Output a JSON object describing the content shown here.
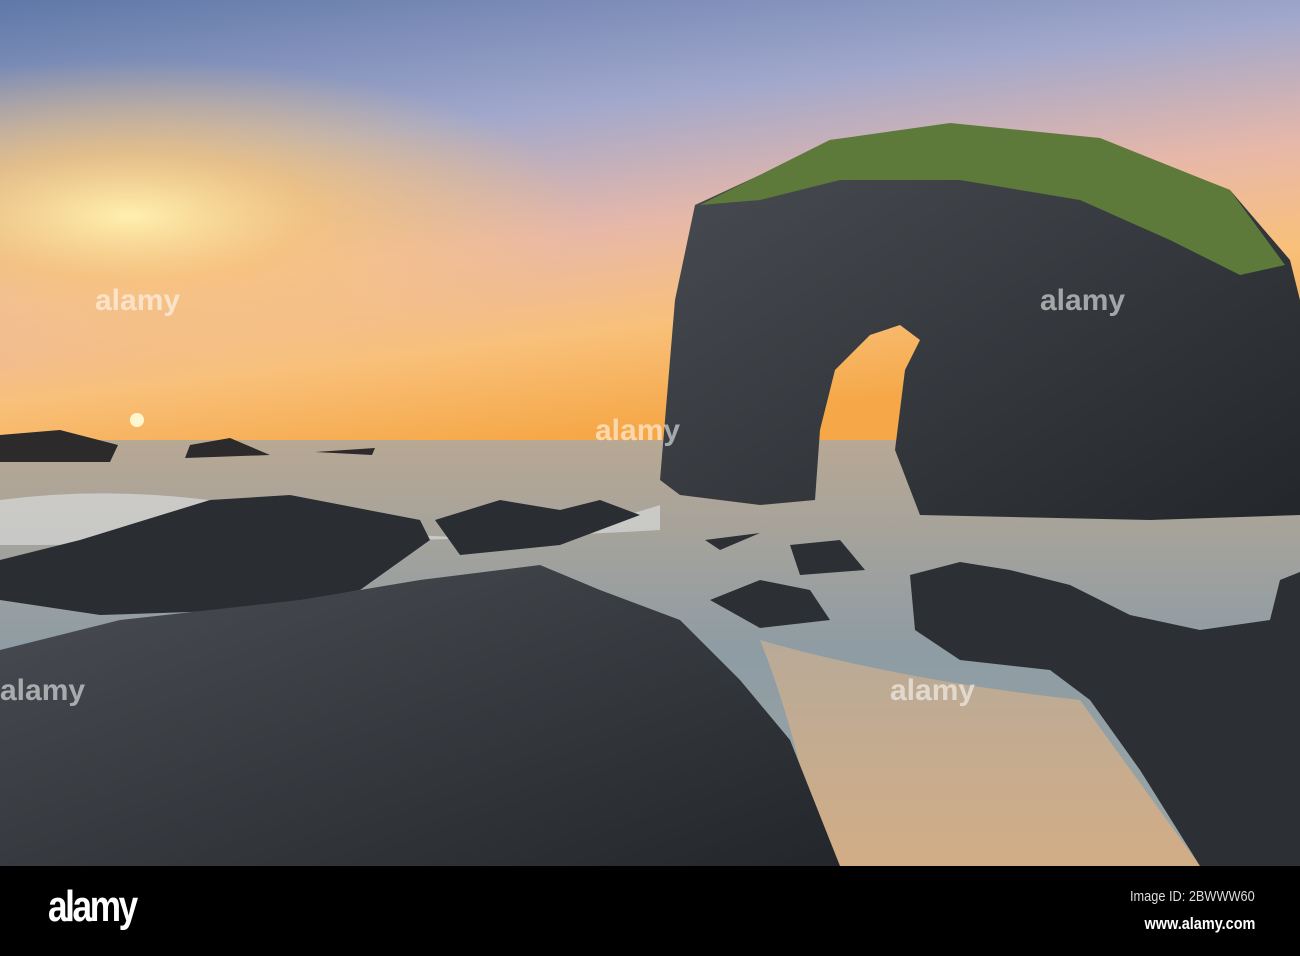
{
  "photo": {
    "subject": "sea arch rock at sunrise",
    "watermark": "alamy",
    "colors": {
      "sun": "#ffd98a",
      "sky_top": "#6c86b6",
      "sea": "#8a9aa4",
      "rock": "#2e3236",
      "sand": "#c9a987",
      "grass": "#5d7a3a"
    }
  },
  "footer": {
    "logo": "alamy",
    "image_id": "Image ID: 2BWWW60",
    "website": "www.alamy.com"
  }
}
